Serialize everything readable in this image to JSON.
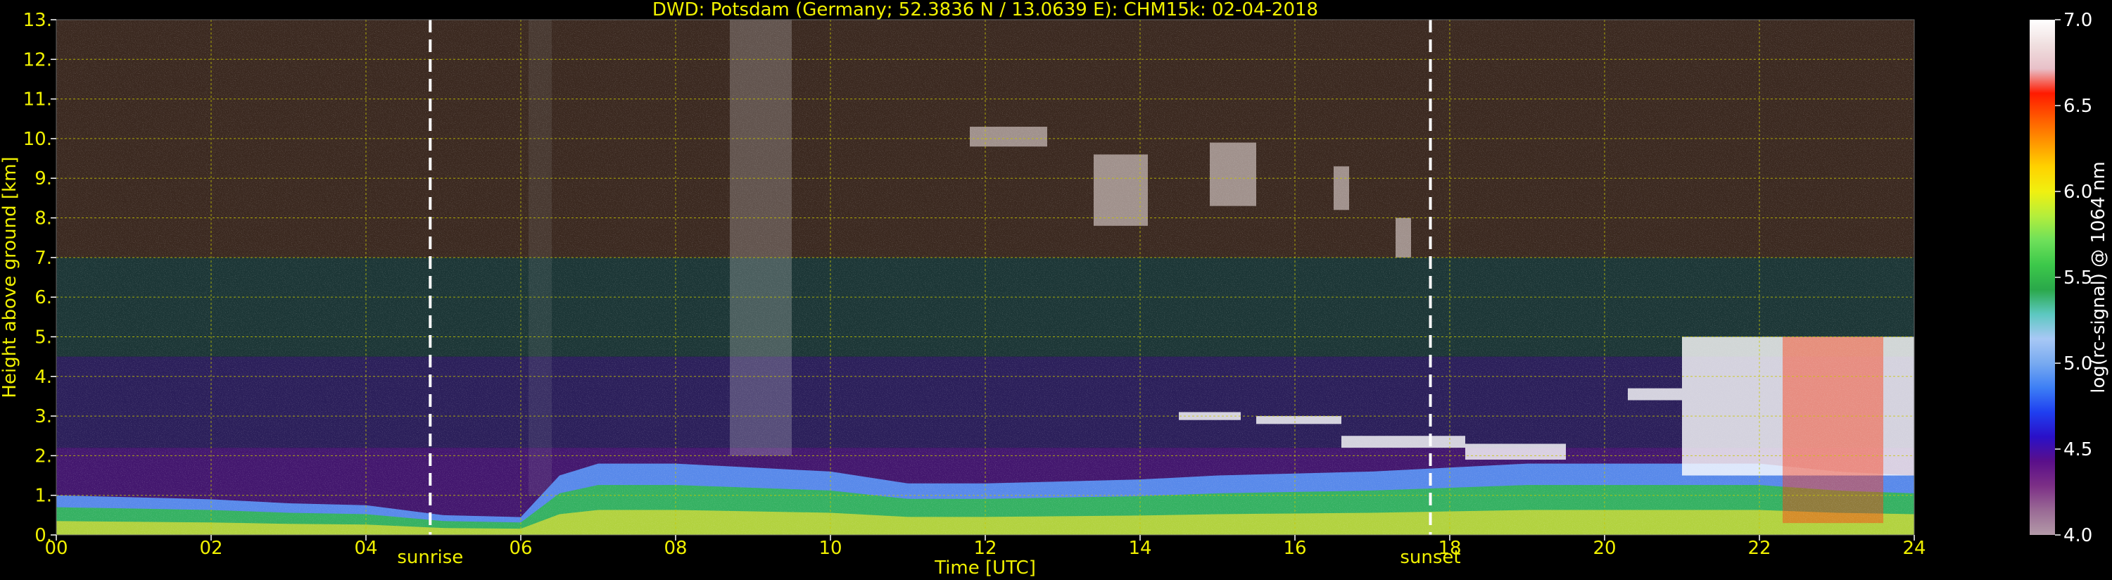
{
  "chart_data": {
    "type": "heatmap",
    "title": "DWD: Potsdam (Germany; 52.3836 N / 13.0639 E):    CHM15k: 02-04-2018",
    "xlabel": "Time [UTC]",
    "ylabel": "Height above ground [km]",
    "xlim": [
      0,
      24
    ],
    "ylim": [
      0,
      13
    ],
    "x_ticks": [
      0,
      2,
      4,
      6,
      8,
      10,
      12,
      14,
      16,
      18,
      20,
      22,
      24
    ],
    "x_tick_labels": [
      "00",
      "02",
      "04",
      "06",
      "08",
      "10",
      "12",
      "14",
      "16",
      "18",
      "20",
      "22",
      "24"
    ],
    "y_ticks": [
      0,
      1,
      2,
      3,
      4,
      5,
      6,
      7,
      8,
      9,
      10,
      11,
      12,
      13
    ],
    "y_tick_labels": [
      "0.",
      "1.",
      "2.",
      "3.",
      "4.",
      "5.",
      "6.",
      "7.",
      "8.",
      "9.",
      "10.",
      "11.",
      "12.",
      "13."
    ],
    "grid": true,
    "events": [
      {
        "label": "sunrise",
        "time": 4.83
      },
      {
        "label": "sunset",
        "time": 17.75
      }
    ],
    "colorbar": {
      "label": "log(rc-signal) @ 1064 nm",
      "range": [
        4.0,
        7.0
      ],
      "ticks": [
        4.0,
        4.5,
        5.0,
        5.5,
        6.0,
        6.5,
        7.0
      ],
      "tick_labels": [
        "4.0",
        "4.5",
        "5.0",
        "5.5",
        "6.0",
        "6.5",
        "7.0"
      ],
      "colors": [
        "#b39aa8",
        "#9a6a95",
        "#7c2f86",
        "#5a0f8a",
        "#2a10c8",
        "#1f3ff0",
        "#3d7ff5",
        "#78aaf0",
        "#a8c8f5",
        "#5cc8c0",
        "#2aa84a",
        "#3cc84a",
        "#6ee05a",
        "#b4ee3c",
        "#f0f010",
        "#ffd200",
        "#ff9600",
        "#ff5a00",
        "#ff1a00",
        "#e8c0c8",
        "#f0e0e0",
        "#ffffff"
      ]
    },
    "features": {
      "boundary_layer_height_km": [
        [
          0,
          1.0
        ],
        [
          1,
          0.95
        ],
        [
          2,
          0.9
        ],
        [
          3,
          0.8
        ],
        [
          4,
          0.75
        ],
        [
          5,
          0.5
        ],
        [
          6,
          0.45
        ],
        [
          6.5,
          1.5
        ],
        [
          7,
          1.8
        ],
        [
          8,
          1.8
        ],
        [
          9,
          1.7
        ],
        [
          10,
          1.6
        ],
        [
          11,
          1.3
        ],
        [
          12,
          1.3
        ],
        [
          13,
          1.35
        ],
        [
          14,
          1.4
        ],
        [
          15,
          1.5
        ],
        [
          16,
          1.55
        ],
        [
          17,
          1.6
        ],
        [
          18,
          1.7
        ],
        [
          19,
          1.8
        ],
        [
          20,
          1.8
        ],
        [
          21,
          1.8
        ],
        [
          22,
          1.8
        ],
        [
          23,
          1.6
        ],
        [
          24,
          1.5
        ]
      ],
      "cirrus_clouds": [
        {
          "t_start": 11.8,
          "t_end": 12.8,
          "base_km": 9.8,
          "top_km": 10.3
        },
        {
          "t_start": 13.4,
          "t_end": 14.1,
          "base_km": 7.8,
          "top_km": 9.6
        },
        {
          "t_start": 14.9,
          "t_end": 15.5,
          "base_km": 8.3,
          "top_km": 9.9
        },
        {
          "t_start": 16.5,
          "t_end": 16.7,
          "base_km": 8.2,
          "top_km": 9.3
        },
        {
          "t_start": 17.3,
          "t_end": 17.5,
          "base_km": 7.0,
          "top_km": 8.0
        }
      ],
      "low_clouds": [
        {
          "t_start": 14.5,
          "t_end": 15.3,
          "base_km": 2.9,
          "top_km": 3.1
        },
        {
          "t_start": 15.5,
          "t_end": 16.6,
          "base_km": 2.8,
          "top_km": 3.0
        },
        {
          "t_start": 16.6,
          "t_end": 18.2,
          "base_km": 2.2,
          "top_km": 2.5
        },
        {
          "t_start": 18.2,
          "t_end": 19.5,
          "base_km": 1.9,
          "top_km": 2.3
        },
        {
          "t_start": 20.3,
          "t_end": 21.0,
          "base_km": 3.4,
          "top_km": 3.7
        },
        {
          "t_start": 21.0,
          "t_end": 24.0,
          "base_km": 1.5,
          "top_km": 5.0
        }
      ]
    }
  }
}
